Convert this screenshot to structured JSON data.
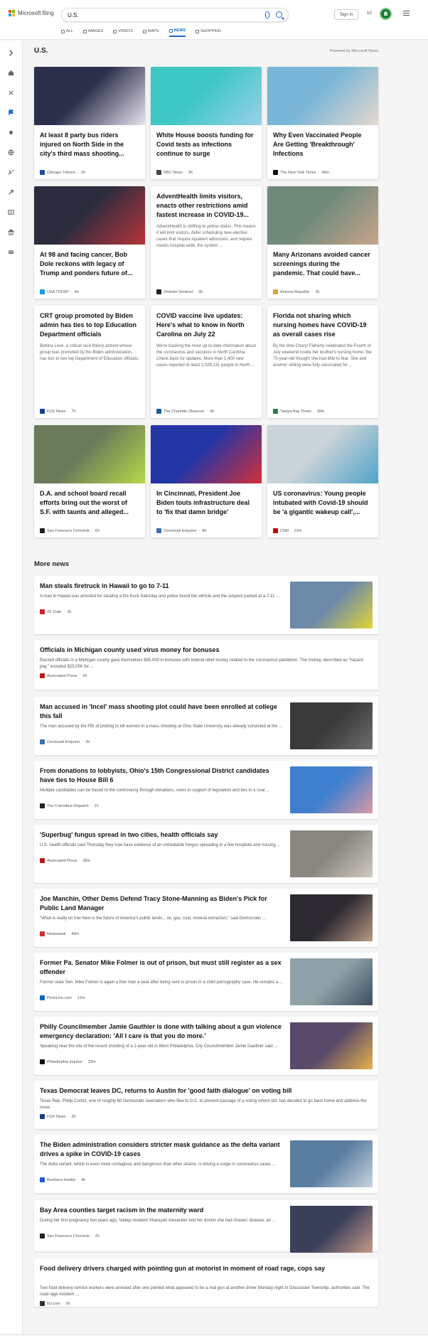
{
  "header": {
    "brand": "Microsoft Bing",
    "query": "U.S.",
    "signin": "Sign in",
    "points": "10"
  },
  "tabs": [
    {
      "label": "ALL"
    },
    {
      "label": "IMAGES"
    },
    {
      "label": "VIDEOS"
    },
    {
      "label": "MAPS"
    },
    {
      "label": "NEWS",
      "active": true
    },
    {
      "label": "SHOPPING"
    }
  ],
  "section": {
    "title": "U.S.",
    "powered": "Powered by Microsoft News"
  },
  "cards": [
    {
      "title": "At least 8 party bus riders injured on North Side in the city's third mass shooting...",
      "source": "Chicago Tribune",
      "time": "2h",
      "colors": [
        "#2b2f4a",
        "#e8e3f0"
      ],
      "icon": "#1f4e9c"
    },
    {
      "title": "White House boosts funding for Covid tests as infections continue to surge",
      "source": "NBC News",
      "time": "3h",
      "colors": [
        "#3ec8c4",
        "#9ad0e8"
      ],
      "icon": "#444"
    },
    {
      "title": "Why Even Vaccinated People Are Getting 'Breakthrough' Infections",
      "source": "The New York Times",
      "time": "49m",
      "colors": [
        "#79b6d8",
        "#e6d8cc"
      ],
      "icon": "#111"
    },
    {
      "title": "At 98 and facing cancer, Bob Dole reckons with legacy of Trump and ponders future of...",
      "source": "USA TODAY",
      "time": "4h",
      "colors": [
        "#2a2c3e",
        "#b8353a"
      ],
      "icon": "#1a9be0"
    },
    {
      "title": "AdventHealth limits visitors, enacts other restrictions amid fastest increase in COVID-19...",
      "snippet": "AdventHealth is shifting to yellow status. This means it will limit visitors, defer scheduling new elective cases that require inpatient admission, and require masks hospital-wide, the system ...",
      "source": "Orlando Sentinel",
      "time": "3h",
      "icon": "#222"
    },
    {
      "title": "Many Arizonans avoided cancer screenings during the pandemic. That could have...",
      "source": "Arizona Republic",
      "time": "3h",
      "colors": [
        "#6f8a7b",
        "#caa48a"
      ],
      "icon": "#d8a33a"
    },
    {
      "title": "CRT group promoted by Biden admin has ties to top Education Department officials",
      "snippet": "Bettina Love, a critical race theory activist whose group was promoted by the Biden administration, has ties to two top Department of Education officials.",
      "source": "FOX News",
      "time": "7h",
      "icon": "#1b3d8c"
    },
    {
      "title": "COVID vaccine live updates: Here's what to know in North Carolina on July 22",
      "snippet": "We're tracking the most up-to-date information about the coronavirus and vaccines in North Carolina. Check back for updates. More than 1,400 new cases reported At least 1,028,131 people in North ...",
      "source": "The Charlotte Observer",
      "time": "6h",
      "icon": "#1a5aa0"
    },
    {
      "title": "Florida not sharing which nursing homes have COVID-19 as overall cases rise",
      "snippet": "By the time Cheryl Flaherty celebrated the Fourth of July weekend inside her brother's nursing home, the 75-year-old thought she had little to fear. She and another sibling were fully vaccinated for ...",
      "source": "Tampa Bay Times",
      "time": "39m",
      "icon": "#2f7a4a"
    },
    {
      "title": "D.A. and school board recall efforts bring out the worst of S.F. with taunts and alleged...",
      "source": "San Francisco Chronicle",
      "time": "6h",
      "colors": [
        "#6a7a5a",
        "#b7d84a"
      ],
      "icon": "#222"
    },
    {
      "title": "In Cincinnati, President Joe Biden touts infrastructure deal to 'fix that damn bridge'",
      "source": "Cincinnati Enquirer",
      "time": "8h",
      "colors": [
        "#2436a6",
        "#d22f3a"
      ],
      "icon": "#3b6fb5"
    },
    {
      "title": "US coronavirus: Young people intubated with Covid-19 should be 'a gigantic wakeup call',...",
      "source": "CNN",
      "time": "22m",
      "colors": [
        "#c9d3d8",
        "#4fa3c9"
      ],
      "icon": "#cc0000"
    }
  ],
  "more_title": "More news",
  "news": [
    {
      "title": "Man steals firetruck in Hawaii to go to 7-11",
      "snippet": "A man in Hawaii was arrested for stealing a fire truck Saturday and police found the vehicle and the suspect parked at a 7-11 ...",
      "source": "SF Gate",
      "time": "2h",
      "img": [
        "#6d8aa8",
        "#e2d537"
      ],
      "icon": "#c62828"
    },
    {
      "title": "Officials in Michigan county used virus money for bonuses",
      "snippet": "Elected officials in a Michigan county gave themselves $65,000 in bonuses with federal relief money related to the coronavirus pandemic. The money, described as \"hazard pay,\" included $25,000 for ...",
      "source": "Associated Press",
      "time": "2h",
      "icon": "#b71c1c"
    },
    {
      "title": "Man accused in 'Incel' mass shooting plot could have been enrolled at college this fall",
      "snippet": "The man accused by the FBI of plotting to kill women in a mass shooting at Ohio State University was already convicted at the ...",
      "source": "Cincinnati Enquirer",
      "time": "2h",
      "img": [
        "#3a3a3a",
        "#6e6e6e"
      ],
      "icon": "#3b6fb5"
    },
    {
      "title": "From donations to lobbyists, Ohio's 15th Congressional District candidates have ties to House Bill 6",
      "snippet": "Multiple candidates can be traced to the controversy through donations, votes in support of legislation and ties to a coal ...",
      "source": "The Columbus Dispatch",
      "time": "2h",
      "img": [
        "#3f7fd0",
        "#d99aa6"
      ],
      "icon": "#222"
    },
    {
      "title": "'Superbug' fungus spread in two cities, health officials say",
      "snippet": "U.S. health officials said Thursday they now have evidence of an untreatable fungus spreading in a few hospitals and nursing ...",
      "source": "Associated Press",
      "time": "38m",
      "img": [
        "#8a8780",
        "#cfcac2"
      ],
      "icon": "#b71c1c"
    },
    {
      "title": "Joe Manchin, Other Dems Defend Tracy Stone-Manning as Biden's Pick for Public Land Manager",
      "snippet": "\"What is really on trial here is the future of America's public lands... oil, gas, coal, mineral extraction,\" said Democratic ...",
      "source": "Newsweek",
      "time": "49m",
      "img": [
        "#2c2a30",
        "#b89a84"
      ],
      "icon": "#d32f2f"
    },
    {
      "title": "Former Pa. Senator Mike Folmer is out of prison, but must still register as a sex offender",
      "snippet": "Former state Sen. Mike Folmer is again a free man a year after being sent to prison in a child pornography case. He remains a ...",
      "source": "PennLive.com",
      "time": "12m",
      "img": [
        "#8fa0a8",
        "#3c4d5e"
      ],
      "icon": "#1565c0"
    },
    {
      "title": "Philly Councilmember Jamie Gauthier is done with talking about a gun violence emergency declaration: 'All I care is that you do more.'",
      "snippet": "Speaking near the site of the recent shooting of a 1-year-old in West Philadelphia, City Councilmember Jamie Gauthier said ...",
      "source": "Philadelphia Inquirer",
      "time": "23m",
      "img": [
        "#5a4a6a",
        "#e6b24a"
      ],
      "icon": "#111"
    },
    {
      "title": "Texas Democrat leaves DC, returns to Austin for 'good faith dialogue' on voting bill",
      "snippet": "Texas Rep. Philip Cortez, one of roughly 60 Democratic lawmakers who flew to D.C. to prevent passage of a voting reform bill, has decided to go back home and address the issue.",
      "source": "FOX News",
      "time": "2h",
      "icon": "#1b3d8c"
    },
    {
      "title": "The Biden administration considers stricter mask guidance as the delta variant drives a spike in COVID-19 cases",
      "snippet": "The delta variant, which is even more contagious and dangerous than other strains, is driving a surge in coronavirus cases ...",
      "source": "Business Insider",
      "time": "4h",
      "img": [
        "#5a7ea0",
        "#c9d4de"
      ],
      "icon": "#1e5bd6"
    },
    {
      "title": "Bay Area counties target racism in the maternity ward",
      "snippet": "During her first pregnancy two years ago, Vallejo resident Sharayah Alexander told her doctor she had Graves' disease, an ...",
      "source": "San Francisco Chronicle",
      "time": "2h",
      "img": [
        "#3a3f5a",
        "#c79a8a"
      ],
      "icon": "#222"
    },
    {
      "title": "Food delivery drivers charged with pointing gun at motorist in moment of road rage, cops say",
      "snippet": "Two food delivery service workers were arrested after one pointed what appeared to be a real gun at another driver Monday night in Gloucester Township, authorities said. The road rage incident ...",
      "source": "NJ.com",
      "time": "2h",
      "icon": "#333"
    }
  ]
}
